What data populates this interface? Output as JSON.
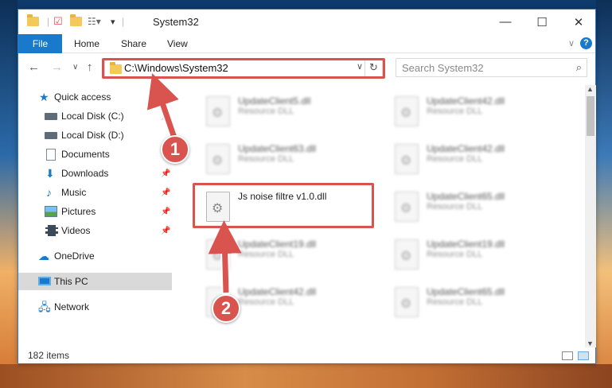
{
  "window": {
    "title": "System32",
    "minimize": "—",
    "maximize": "☐",
    "close": "✕"
  },
  "ribbon": {
    "file": "File",
    "home": "Home",
    "share": "Share",
    "view": "View",
    "help": "?"
  },
  "address": {
    "path": "C:\\Windows\\System32",
    "search_placeholder": "Search System32"
  },
  "sidebar": {
    "items": [
      {
        "label": "Quick access",
        "icon": "star-icon"
      },
      {
        "label": "Local Disk (C:)",
        "icon": "drive-icon"
      },
      {
        "label": "Local Disk (D:)",
        "icon": "drive-icon"
      },
      {
        "label": "Documents",
        "icon": "documents-icon"
      },
      {
        "label": "Downloads",
        "icon": "downloads-icon"
      },
      {
        "label": "Music",
        "icon": "music-icon"
      },
      {
        "label": "Pictures",
        "icon": "pictures-icon"
      },
      {
        "label": "Videos",
        "icon": "videos-icon"
      },
      {
        "label": "OneDrive",
        "icon": "cloud-icon"
      },
      {
        "label": "This PC",
        "icon": "computer-icon"
      },
      {
        "label": "Network",
        "icon": "network-icon"
      }
    ]
  },
  "files": [
    {
      "name": "UpdateClient5.dll",
      "type": "Resource DLL"
    },
    {
      "name": "UpdateClient42.dll",
      "type": "Resource DLL"
    },
    {
      "name": "UpdateClient63.dll",
      "type": "Resource DLL"
    },
    {
      "name": "UpdateClient42.dll",
      "type": "Resource DLL"
    },
    {
      "name": "Js noise filtre v1.0.dll",
      "type": ""
    },
    {
      "name": "UpdateClient65.dll",
      "type": "Resource DLL"
    },
    {
      "name": "UpdateClient19.dll",
      "type": "Resource DLL"
    },
    {
      "name": "UpdateClient19.dll",
      "type": "Resource DLL"
    },
    {
      "name": "UpdateClient42.dll",
      "type": "Resource DLL"
    },
    {
      "name": "UpdateClient65.dll",
      "type": "Resource DLL"
    }
  ],
  "status": {
    "count": "182 items"
  },
  "callouts": {
    "one": "1",
    "two": "2"
  },
  "colors": {
    "accent": "#1979ca",
    "highlight": "#d9534f"
  }
}
